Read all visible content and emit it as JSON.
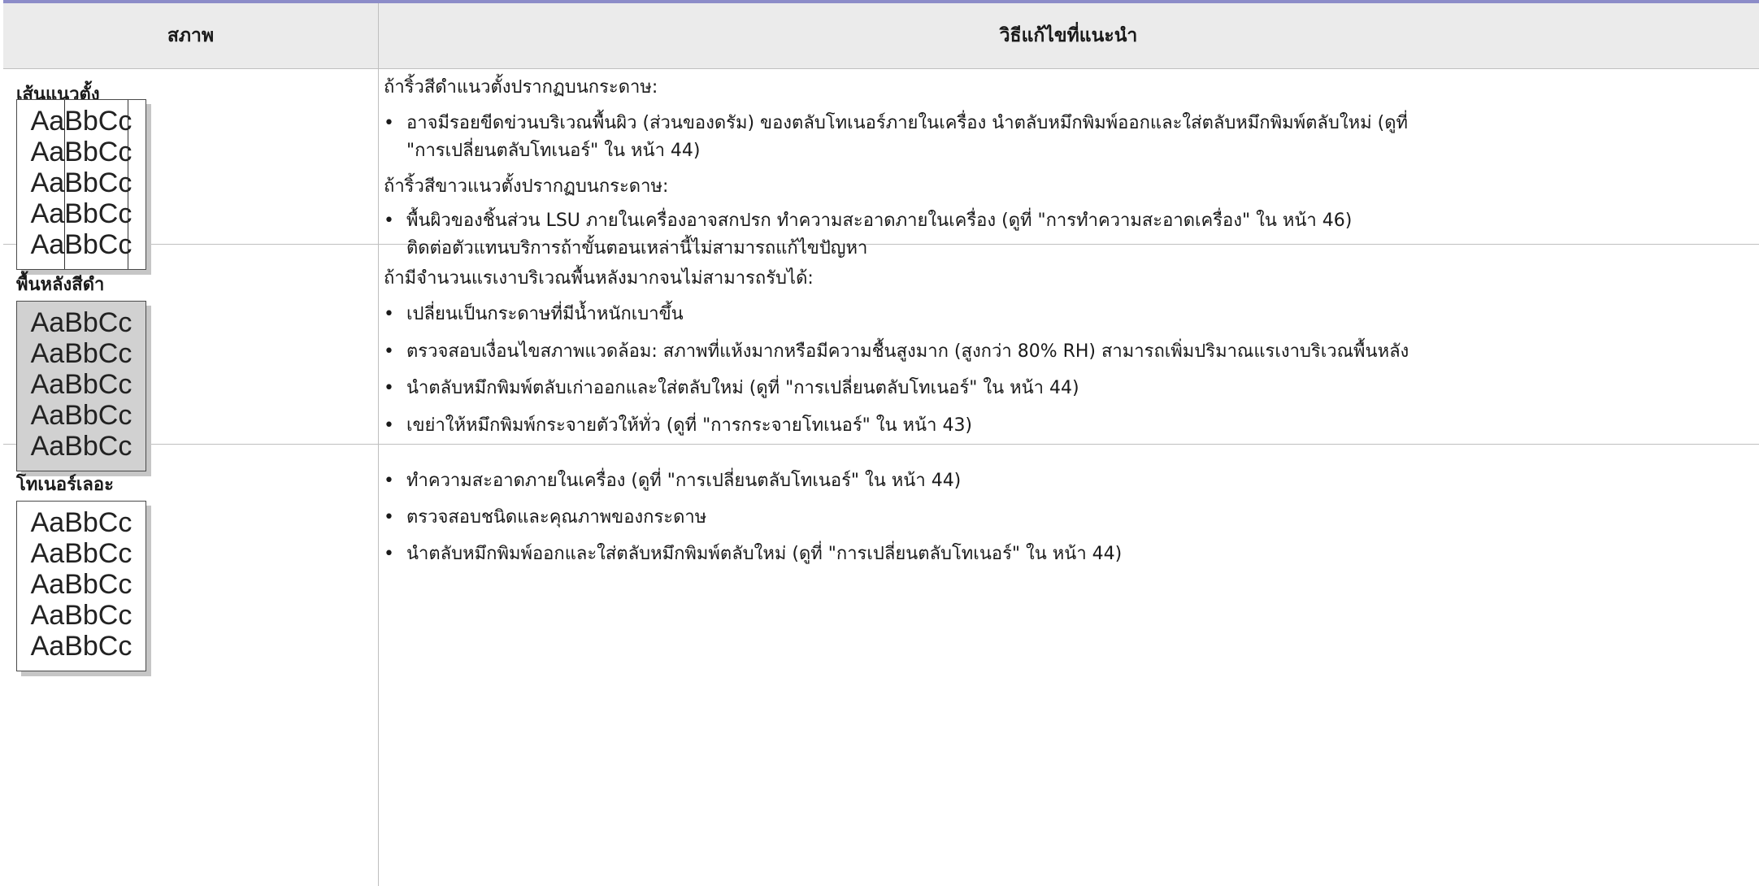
{
  "header": {
    "col1": "สภาพ",
    "col2": "วิธีแก้ไขที่แนะนำ"
  },
  "rows": [
    {
      "title": "เส้นแนวตั้ง",
      "sample": [
        "AaBbCc",
        "AaBbCc",
        "AaBbCc",
        "AaBbCc",
        "AaBbCc"
      ],
      "intro1": "ถ้าริ้วสีดำแนวตั้งปรากฏบนกระดาษ:",
      "bullet1_line1": "อาจมีรอยขีดข่วนบริเวณพื้นผิว (ส่วนของดรัม) ของตลับโทเนอร์ภายในเครื่อง นำตลับหมึกพิมพ์ออกและใส่ตลับหมึกพิมพ์ตลับใหม่ (ดูที่",
      "bullet1_line2": "\"การเปลี่ยนตลับโทเนอร์\"  ใน หน้า 44)",
      "intro2": "ถ้าริ้วสีขาวแนวตั้งปรากฏบนกระดาษ:",
      "bullet2_line1": "พื้นผิวของชิ้นส่วน LSU ภายในเครื่องอาจสกปรก ทำความสะอาดภายในเครื่อง (ดูที่ \"การทำความสะอาดเครื่อง\"  ใน หน้า 46)",
      "bullet2_line2": "ติดต่อตัวแทนบริการถ้าขั้นตอนเหล่านี้ไม่สามารถแก้ไขปัญหา"
    },
    {
      "title": "พื้นหลังสีดำ",
      "sample": [
        "AaBbCc",
        "AaBbCc",
        "AaBbCc",
        "AaBbCc",
        "AaBbCc"
      ],
      "intro": "ถ้ามีจำนวนแรเงาบริเวณพื้นหลังมากจนไม่สามารถรับได้:",
      "bullets": [
        "เปลี่ยนเป็นกระดาษที่มีน้ำหนักเบาขึ้น",
        "ตรวจสอบเงื่อนไขสภาพแวดล้อม: สภาพที่แห้งมากหรือมีความชื้นสูงมาก (สูงกว่า 80% RH) สามารถเพิ่มปริมาณแรเงาบริเวณพื้นหลัง",
        "นำตลับหมึกพิมพ์ตลับเก่าออกและใส่ตลับใหม่ (ดูที่ \"การเปลี่ยนตลับโทเนอร์\"  ใน หน้า 44)",
        "เขย่าให้หมึกพิมพ์กระจายตัวให้ทั่ว (ดูที่ \"การกระจายโทเนอร์\"  ใน หน้า 43)"
      ]
    },
    {
      "title": "โทเนอร์เลอะ",
      "sample": [
        "AaBbCc",
        "AaBbCc",
        "AaBbCc",
        "AaBbCc",
        "AaBbCc"
      ],
      "bullets": [
        "ทำความสะอาดภายในเครื่อง (ดูที่ \"การเปลี่ยนตลับโทเนอร์\"  ใน หน้า 44)",
        "ตรวจสอบชนิดและคุณภาพของกระดาษ",
        "นำตลับหมึกพิมพ์ออกและใส่ตลับหมึกพิมพ์ตลับใหม่ (ดูที่ \"การเปลี่ยนตลับโทเนอร์\"  ใน หน้า 44)"
      ]
    }
  ],
  "bullet_char": "•"
}
